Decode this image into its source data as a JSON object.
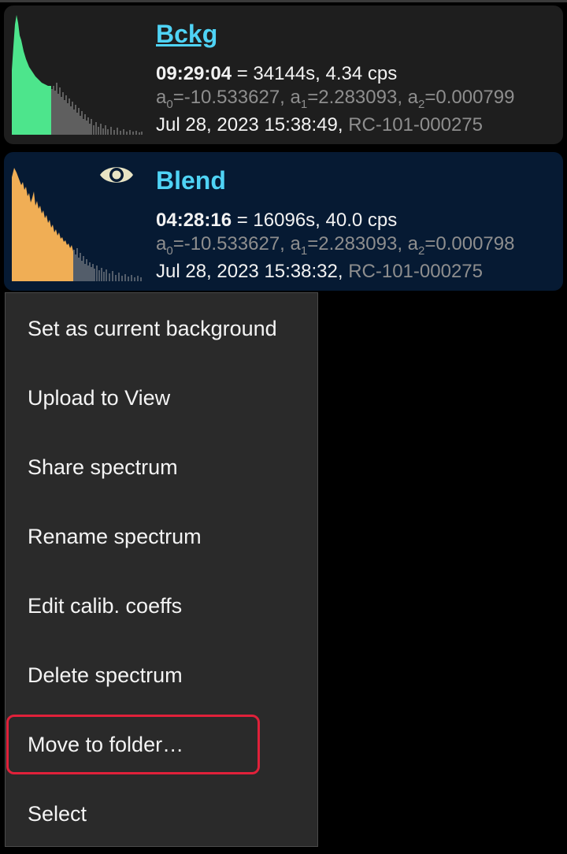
{
  "spectra": [
    {
      "title": "Bckg",
      "duration": "09:29:04",
      "duration_rest": " = 34144s, 4.34 cps",
      "a0_label": "a",
      "a0_sub": "0",
      "a0_value": "=-10.533627, ",
      "a1_label": "a",
      "a1_sub": "1",
      "a1_value": "=2.283093, ",
      "a2_label": "a",
      "a2_sub": "2",
      "a2_value": "=0.000799",
      "date": "Jul 28, 2023 15:38:49, ",
      "device": "RC-101-000275",
      "thumb_color": "#4de58c",
      "background": "#1e1e1e"
    },
    {
      "title": "Blend",
      "duration": "04:28:16",
      "duration_rest": " = 16096s, 40.0 cps",
      "a0_label": "a",
      "a0_sub": "0",
      "a0_value": "=-10.533627, ",
      "a1_label": "a",
      "a1_sub": "1",
      "a1_value": "=2.283093, ",
      "a2_label": "a",
      "a2_sub": "2",
      "a2_value": "=0.000798",
      "date": "Jul 28, 2023 15:38:32, ",
      "device": "RC-101-000275",
      "thumb_color": "#f0ae55",
      "icon": "eye-icon",
      "background": "#061a33"
    }
  ],
  "menu": {
    "items": [
      "Set as current background",
      "Upload to View",
      "Share spectrum",
      "Rename spectrum",
      "Edit calib. coeffs",
      "Delete spectrum",
      "Move to folder…",
      "Select"
    ],
    "highlighted_item": "Move to folder…",
    "highlight_color": "#e0213a"
  },
  "colors": {
    "title": "#4fd3f5",
    "menu_background": "#2a2a2a"
  }
}
